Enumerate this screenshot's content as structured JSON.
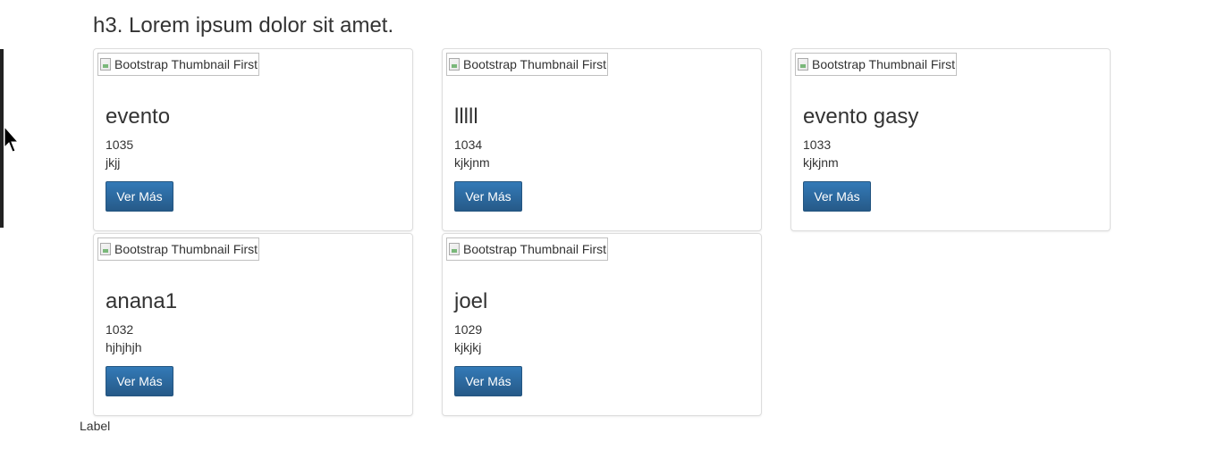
{
  "heading": "h3. Lorem ipsum dolor sit amet.",
  "accent_color": "#337ab7",
  "cards": [
    {
      "thumb_alt": "Bootstrap Thumbnail First",
      "title": "evento",
      "id": "1035",
      "desc": "jkjj",
      "button": "Ver Más"
    },
    {
      "thumb_alt": "Bootstrap Thumbnail First",
      "title": "lllll",
      "id": "1034",
      "desc": "kjkjnm",
      "button": "Ver Más"
    },
    {
      "thumb_alt": "Bootstrap Thumbnail First",
      "title": "evento gasy",
      "id": "1033",
      "desc": "kjkjnm",
      "button": "Ver Más"
    },
    {
      "thumb_alt": "Bootstrap Thumbnail First",
      "title": "anana1",
      "id": "1032",
      "desc": "hjhjhjh",
      "button": "Ver Más"
    },
    {
      "thumb_alt": "Bootstrap Thumbnail First",
      "title": "joel",
      "id": "1029",
      "desc": "kjkjkj",
      "button": "Ver Más"
    }
  ],
  "footer_label": "Label",
  "icons": {
    "thumbnail": "broken-image-icon",
    "pointer": "mouse-pointer-icon"
  }
}
